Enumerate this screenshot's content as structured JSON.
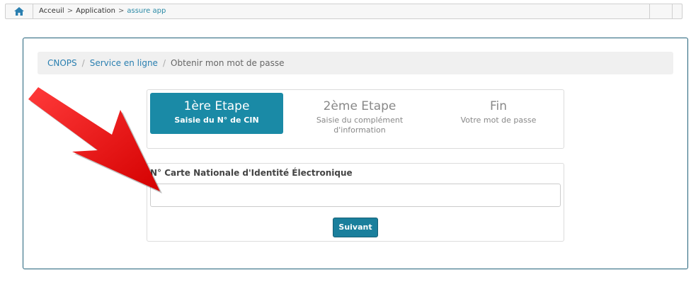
{
  "topbar": {
    "icon": "home-icon",
    "breadcrumb": [
      "Acceuil",
      "Application",
      "assure app"
    ],
    "separator": ">"
  },
  "panel": {
    "breadcrumb": {
      "items": [
        "CNOPS",
        "Service en ligne",
        "Obtenir mon mot de passe"
      ],
      "separator": "/"
    },
    "steps": [
      {
        "title": "1ère Etape",
        "subtitle": "Saisie du N° de CIN",
        "active": true
      },
      {
        "title": "2ème Etape",
        "subtitle_line1": "Saisie du complément",
        "subtitle_line2": "d'information",
        "active": false
      },
      {
        "title": "Fin",
        "subtitle": "Votre mot de passe",
        "active": false
      }
    ],
    "form": {
      "label": "N° Carte Nationale d'Identité Électronique",
      "value": "",
      "submit": "Suivant"
    }
  },
  "colors": {
    "accent": "#1a8aa6",
    "link": "#2a7fb0",
    "annotation_arrow": "#ee1111"
  }
}
